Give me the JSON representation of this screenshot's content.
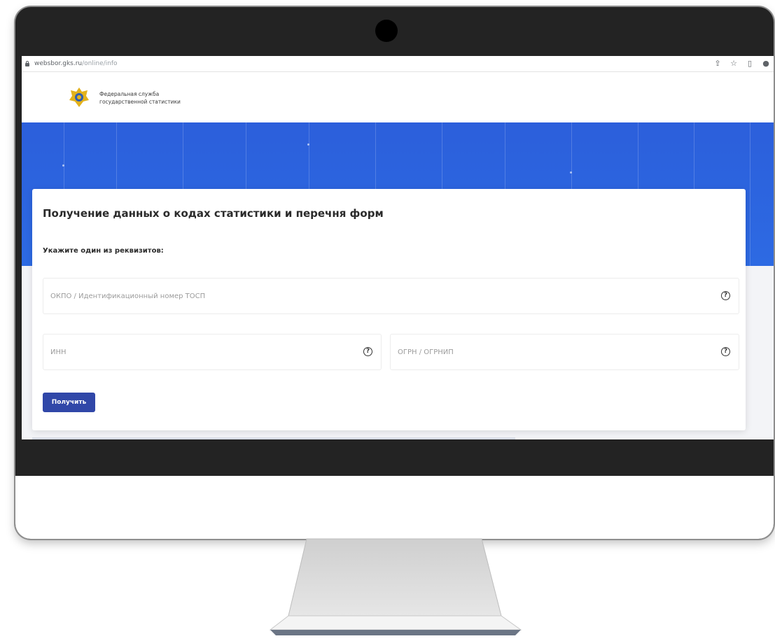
{
  "browser": {
    "url_host": "websbor.gks.ru",
    "url_path": "/online/info",
    "icons": [
      "share-icon",
      "star-icon",
      "sidebar-icon",
      "profile-icon"
    ]
  },
  "header": {
    "logo_line1": "Федеральная служба",
    "logo_line2": "государственной статистики"
  },
  "form": {
    "title": "Получение данных о кодах статистики и перечня форм",
    "subtitle": "Укажите один из реквизитов:",
    "okpo_placeholder": "ОКПО / Идентификационный номер ТОСП",
    "inn_placeholder": "ИНН",
    "ogrn_placeholder": "ОГРН / ОГРНИП",
    "submit_label": "Получить"
  },
  "colors": {
    "hero_blue": "#2c5fdb",
    "button_blue": "#3047a8",
    "monitor_bezel": "#232323"
  }
}
